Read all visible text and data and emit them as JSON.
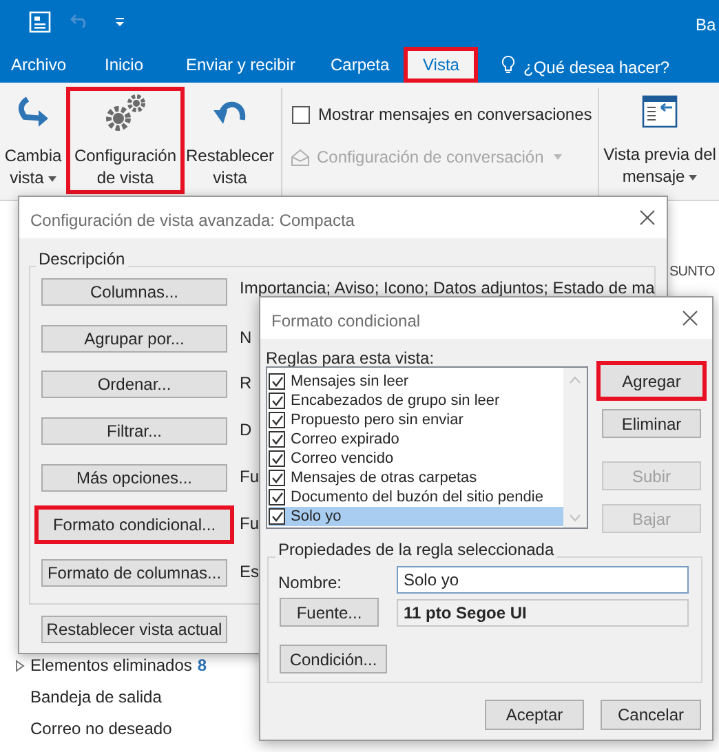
{
  "title_bar": {
    "account": "Ba"
  },
  "tabs": [
    {
      "label": "Archivo",
      "selected": false,
      "highlighted": false
    },
    {
      "label": "Inicio",
      "selected": false,
      "highlighted": false
    },
    {
      "label": "Enviar y recibir",
      "selected": false,
      "highlighted": false
    },
    {
      "label": "Carpeta",
      "selected": false,
      "highlighted": false
    },
    {
      "label": "Vista",
      "selected": true,
      "highlighted": true
    }
  ],
  "tell_me": "¿Qué desea hacer?",
  "ribbon": {
    "buttons": [
      {
        "kind": "change",
        "lines": [
          "Cambia",
          "vista"
        ],
        "dropdown": true,
        "highlighted": false
      },
      {
        "kind": "settings",
        "lines": [
          "Configuración",
          "de vista"
        ],
        "dropdown": false,
        "highlighted": true
      },
      {
        "kind": "reset",
        "lines": [
          "Restablecer",
          "vista"
        ],
        "dropdown": false,
        "highlighted": false
      }
    ],
    "show_conversations": {
      "label": "Mostrar mensajes en conversaciones",
      "checked": false
    },
    "conversation_settings": {
      "label": "Configuración de conversación",
      "disabled": true
    },
    "preview": {
      "lines": [
        "Vista previa del",
        "mensaje"
      ]
    }
  },
  "message_list": {
    "column_header": "SUNTO"
  },
  "folders": [
    {
      "name": "Elementos eliminados",
      "count": "8",
      "expandable": true
    },
    {
      "name": "Bandeja de salida",
      "expandable": false
    },
    {
      "name": "Correo no deseado",
      "expandable": false
    }
  ],
  "view_dialog": {
    "title": "Configuración de vista avanzada: Compacta",
    "group": "Descripción",
    "rows": [
      {
        "button": "Columnas...",
        "description": "Importancia; Aviso; Icono; Datos adjuntos; Estado de ma",
        "highlighted": false
      },
      {
        "button": "Agrupar por...",
        "description": "N",
        "highlighted": false
      },
      {
        "button": "Ordenar...",
        "description": "R",
        "highlighted": false
      },
      {
        "button": "Filtrar...",
        "description": "D",
        "highlighted": false
      },
      {
        "button": "Más opciones...",
        "description": "Fu",
        "highlighted": false
      },
      {
        "button": "Formato condicional...",
        "description": "Fu",
        "highlighted": true
      },
      {
        "button": "Formato de columnas...",
        "description": "Es",
        "highlighted": false
      }
    ],
    "reset_button": "Restablecer vista actual"
  },
  "format_dialog": {
    "title": "Formato condicional",
    "rules_label": "Reglas para esta vista:",
    "rules": [
      {
        "label": "Mensajes sin leer",
        "checked": true,
        "selected": false
      },
      {
        "label": "Encabezados de grupo sin leer",
        "checked": true,
        "selected": false
      },
      {
        "label": "Propuesto pero sin enviar",
        "checked": true,
        "selected": false
      },
      {
        "label": "Correo expirado",
        "checked": true,
        "selected": false
      },
      {
        "label": "Correo vencido",
        "checked": true,
        "selected": false
      },
      {
        "label": "Mensajes de otras carpetas",
        "checked": true,
        "selected": false
      },
      {
        "label": "Documento del buzón del sitio pendie",
        "checked": true,
        "selected": false
      },
      {
        "label": "Solo yo",
        "checked": true,
        "selected": true
      }
    ],
    "side_buttons": [
      {
        "label": "Agregar",
        "disabled": false,
        "highlighted": true
      },
      {
        "label": "Eliminar",
        "disabled": false,
        "highlighted": false
      },
      {
        "label": "Subir",
        "disabled": true,
        "highlighted": false
      },
      {
        "label": "Bajar",
        "disabled": true,
        "highlighted": false
      }
    ],
    "properties": {
      "title": "Propiedades de la regla seleccionada",
      "name_label": "Nombre:",
      "name_value": "Solo yo",
      "font_button": "Fuente...",
      "font_value": "11 pto Segoe UI",
      "condition_button": "Condición..."
    },
    "ok": "Aceptar",
    "cancel": "Cancelar"
  }
}
